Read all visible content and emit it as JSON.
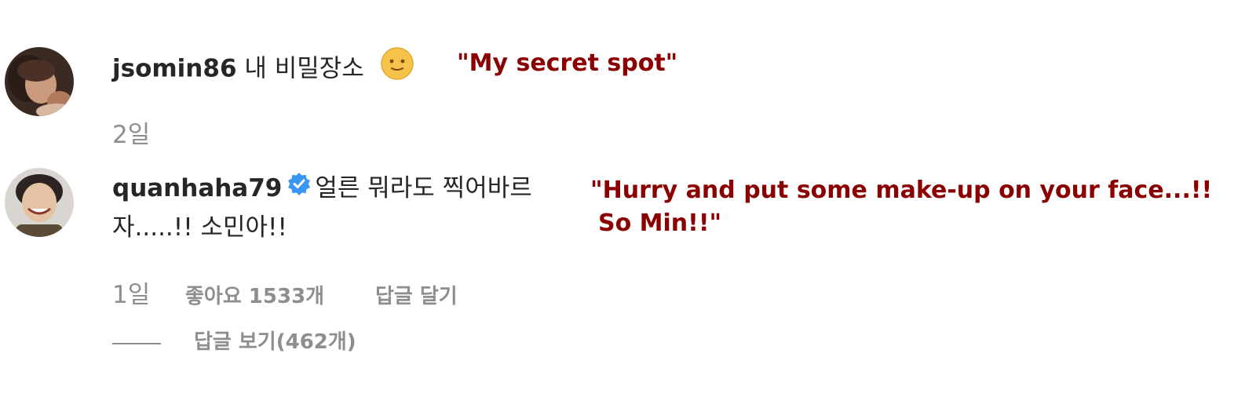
{
  "comments": [
    {
      "username": "jsomin86",
      "text": "내 비밀장소",
      "emoji": "slightly-smiling-face-emoji",
      "time": "2일",
      "translation": "\"My secret spot\""
    },
    {
      "username": "quanhaha79",
      "verified": true,
      "text_line1": "얼른 뭐라도 찍어바르",
      "text_line2": "자.....!! 소민아!!",
      "time": "1일",
      "likes": "좋아요 1533개",
      "reply": "답글 달기",
      "view_replies": "답글 보기(462개)",
      "translation_line1": "\"Hurry and put some make-up on your face...!!",
      "translation_line2": "So Min!!\""
    }
  ],
  "colors": {
    "primary_text": "#262626",
    "secondary_text": "#8e8e8e",
    "translation": "#8b0000",
    "verified_badge": "#3897f0"
  }
}
